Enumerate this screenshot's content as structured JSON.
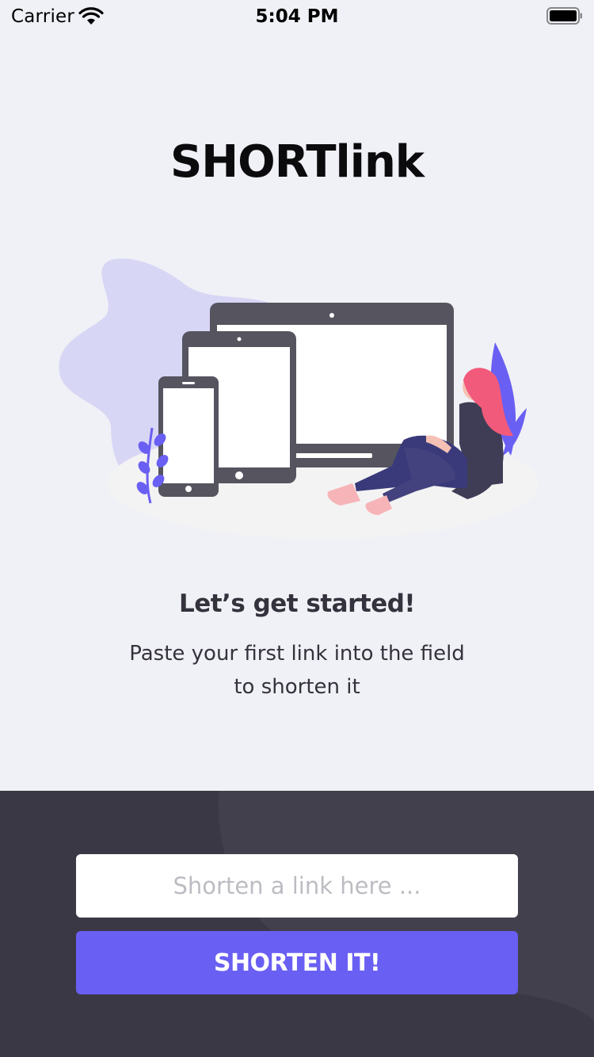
{
  "status_bar": {
    "carrier": "Carrier",
    "time": "5:04 PM",
    "icons": [
      "wifi-icon",
      "battery-icon"
    ]
  },
  "app": {
    "title": "SHORTlink"
  },
  "onboarding": {
    "illustration": "devices-illustration",
    "headline": "Let’s get started!",
    "subtext_line1": "Paste your first link into the field",
    "subtext_line2": "to shorten it"
  },
  "form": {
    "input_value": "",
    "input_placeholder": "Shorten a link here ...",
    "button_label": "SHORTEN IT!"
  },
  "colors": {
    "background": "#f0f1f6",
    "panel": "#3b3846",
    "accent": "#6a5ff3",
    "title_text": "#0b0b0e",
    "body_text": "#35323e"
  }
}
